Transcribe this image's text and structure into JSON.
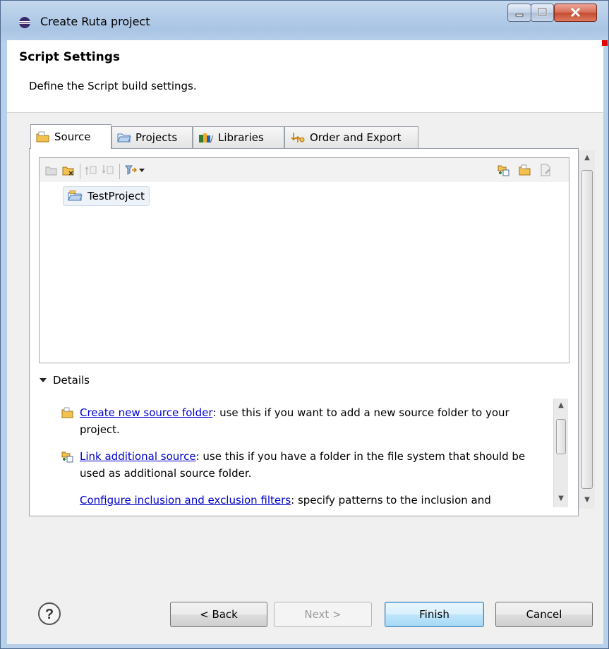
{
  "window": {
    "title": "Create Ruta project",
    "buttons": {
      "minimize": "minimize",
      "maximize": "maximize",
      "close": "close"
    }
  },
  "header": {
    "title": "Script Settings",
    "description": "Define the Script build settings."
  },
  "tabs": [
    {
      "label": "Source",
      "icon": "source-folder-icon",
      "active": true
    },
    {
      "label": "Projects",
      "icon": "projects-folder-icon",
      "active": false
    },
    {
      "label": "Libraries",
      "icon": "libraries-icon",
      "active": false
    },
    {
      "label": "Order and Export",
      "icon": "order-export-icon",
      "active": false
    }
  ],
  "tree": {
    "items": [
      {
        "label": "TestProject",
        "icon": "project-folder-icon"
      }
    ]
  },
  "details": {
    "heading": "Details",
    "rows": [
      {
        "link": "Create new source folder",
        "text": ": use this if you want to add a new source folder to your project.",
        "icon": "new-source-folder-icon"
      },
      {
        "link": "Link additional source",
        "text": ": use this if you have a folder in the file system that should be used as additional source folder.",
        "icon": "link-source-icon"
      },
      {
        "link": "Configure inclusion and exclusion filters",
        "text": ": specify patterns to the inclusion and",
        "icon": "filter-icon"
      }
    ]
  },
  "buttons": {
    "back": "< Back",
    "next": "Next >",
    "finish": "Finish",
    "cancel": "Cancel"
  },
  "colors": {
    "link": "#0000cc",
    "accent_default_button": "#3c7fb1"
  }
}
